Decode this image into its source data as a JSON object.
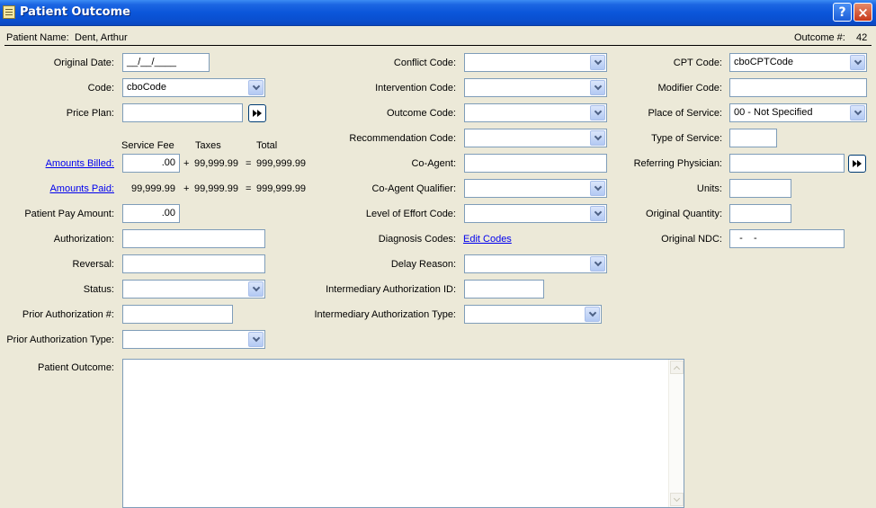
{
  "window": {
    "title": "Patient Outcome",
    "help_label": "?",
    "close_label": "×"
  },
  "header": {
    "patient_name_label": "Patient Name:",
    "patient_name_value": "Dent, Arthur",
    "outcome_num_label": "Outcome #:",
    "outcome_num_value": "42"
  },
  "left": {
    "original_date": {
      "label": "Original Date:",
      "value": "__/__/____"
    },
    "code": {
      "label": "Code:",
      "value": "cboCode"
    },
    "price_plan": {
      "label": "Price Plan:",
      "value": ""
    },
    "amount_headers": {
      "service_fee": "Service Fee",
      "taxes": "Taxes",
      "total": "Total"
    },
    "amounts_billed": {
      "label": "Amounts Billed:",
      "fee": ".00",
      "plus": "+",
      "taxes": "99,999.99",
      "equals": "=",
      "total": "999,999.99"
    },
    "amounts_paid": {
      "label": "Amounts Paid:",
      "fee": "99,999.99",
      "plus": "+",
      "taxes": "99,999.99",
      "equals": "=",
      "total": "999,999.99"
    },
    "patient_pay_amount": {
      "label": "Patient Pay Amount:",
      "value": ".00"
    },
    "authorization": {
      "label": "Authorization:",
      "value": ""
    },
    "reversal": {
      "label": "Reversal:",
      "value": ""
    },
    "status": {
      "label": "Status:",
      "value": ""
    },
    "prior_authorization_num": {
      "label": "Prior Authorization #:",
      "value": ""
    },
    "prior_authorization_type": {
      "label": "Prior Authorization Type:",
      "value": ""
    },
    "patient_outcome": {
      "label": "Patient Outcome:",
      "value": ""
    }
  },
  "middle": {
    "conflict_code": {
      "label": "Conflict Code:",
      "value": ""
    },
    "intervention_code": {
      "label": "Intervention Code:",
      "value": ""
    },
    "outcome_code": {
      "label": "Outcome Code:",
      "value": ""
    },
    "recommendation_code": {
      "label": "Recommendation Code:",
      "value": ""
    },
    "co_agent": {
      "label": "Co-Agent:",
      "value": ""
    },
    "co_agent_qualifier": {
      "label": "Co-Agent Qualifier:",
      "value": ""
    },
    "level_of_effort_code": {
      "label": "Level of Effort Code:",
      "value": ""
    },
    "diagnosis_codes": {
      "label": "Diagnosis Codes:",
      "link": "Edit Codes"
    },
    "delay_reason": {
      "label": "Delay Reason:",
      "value": ""
    },
    "intermediary_authorization_id": {
      "label": "Intermediary Authorization ID:",
      "value": ""
    },
    "intermediary_authorization_type": {
      "label": "Intermediary Authorization Type:",
      "value": ""
    }
  },
  "right": {
    "cpt_code": {
      "label": "CPT Code:",
      "value": "cboCPTCode"
    },
    "modifier_code": {
      "label": "Modifier Code:",
      "value": ""
    },
    "place_of_service": {
      "label": "Place of Service:",
      "value": "00 - Not Specified"
    },
    "type_of_service": {
      "label": "Type of Service:",
      "value": ""
    },
    "referring_physician": {
      "label": "Referring Physician:",
      "value": ""
    },
    "units": {
      "label": "Units:",
      "value": ""
    },
    "original_quantity": {
      "label": "Original Quantity:",
      "value": ""
    },
    "original_ndc": {
      "label": "Original NDC:",
      "value": "  -    -"
    }
  },
  "icons": {
    "window_icon": "notepad-icon",
    "dropdown": "chevron-down-icon",
    "lookup": "fast-forward-icon",
    "scroll_up": "arrow-up-icon",
    "scroll_down": "arrow-down-icon"
  },
  "colors": {
    "titlebar": "#0b56da",
    "background": "#ece9d8",
    "field_border": "#7f9db9",
    "link": "#0000ee",
    "close_button": "#c8391a"
  }
}
